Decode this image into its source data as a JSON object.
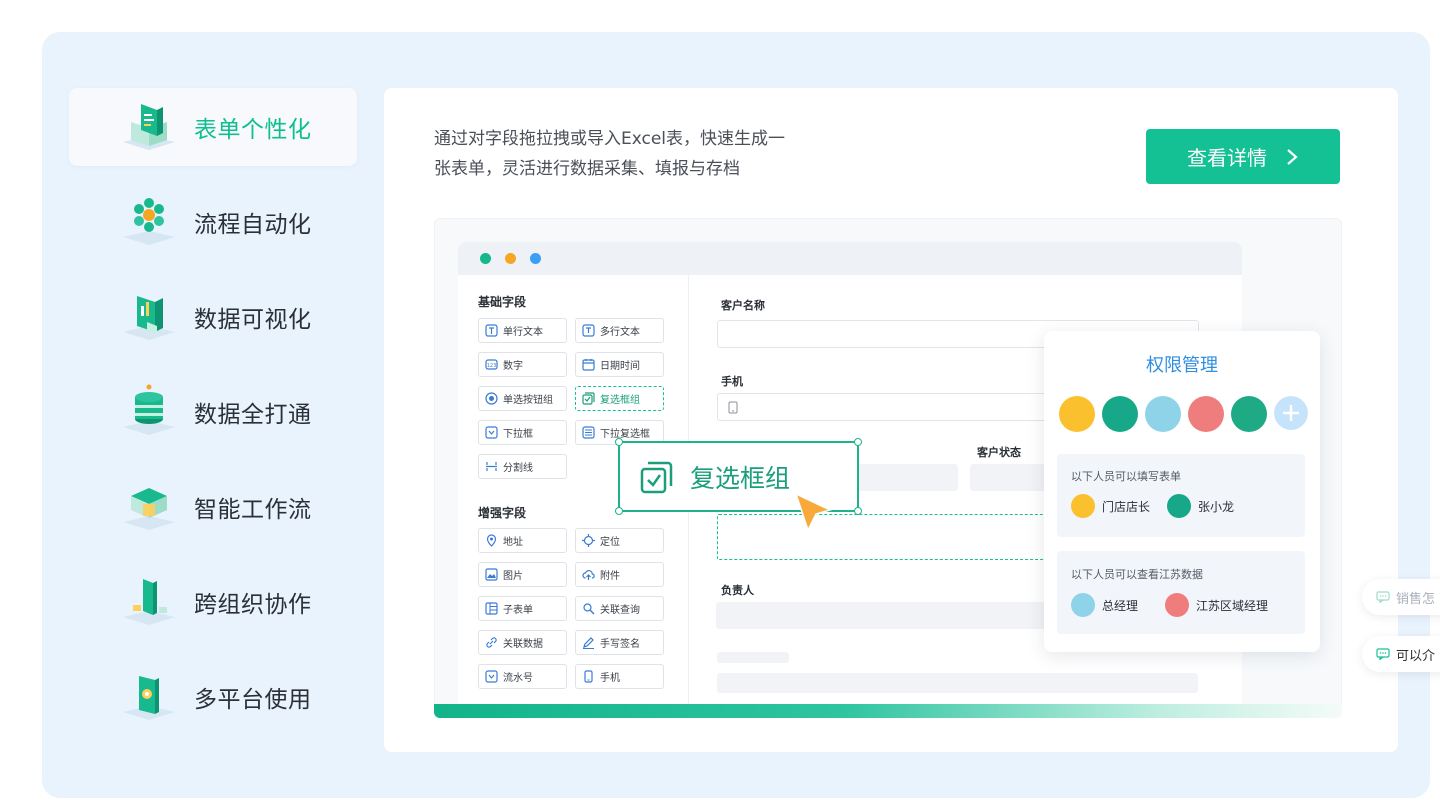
{
  "menu": {
    "items": [
      {
        "label": "表单个性化",
        "icon": "form-icon",
        "active": true
      },
      {
        "label": "流程自动化",
        "icon": "process-icon",
        "active": false
      },
      {
        "label": "数据可视化",
        "icon": "chart-icon",
        "active": false
      },
      {
        "label": "数据全打通",
        "icon": "database-icon",
        "active": false
      },
      {
        "label": "智能工作流",
        "icon": "workflow-icon",
        "active": false
      },
      {
        "label": "跨组织协作",
        "icon": "collaboration-icon",
        "active": false
      },
      {
        "label": "多平台使用",
        "icon": "mobile-icon",
        "active": false
      }
    ]
  },
  "content": {
    "description_line1": "通过对字段拖拉拽或导入Excel表，快速生成一",
    "description_line2": "张表单，灵活进行数据采集、填报与存档",
    "cta_label": "查看详情"
  },
  "builder": {
    "basic_title": "基础字段",
    "basic_fields": [
      "单行文本",
      "多行文本",
      "数字",
      "日期时间",
      "单选按钮组",
      "复选框组",
      "下拉框",
      "下拉复选框",
      "分割线"
    ],
    "enhanced_title": "增强字段",
    "enhanced_fields": [
      "地址",
      "定位",
      "图片",
      "附件",
      "子表单",
      "关联查询",
      "关联数据",
      "手写签名",
      "流水号",
      "手机"
    ],
    "dragging_label": "复选框组",
    "form_labels": {
      "customer_name": "客户名称",
      "phone": "手机",
      "customer_status": "客户状态",
      "owner": "负责人"
    }
  },
  "permission": {
    "title": "权限管理",
    "fill_title": "以下人员可以填写表单",
    "fill_people": [
      "门店店长",
      "张小龙"
    ],
    "view_title": "以下人员可以查看江苏数据",
    "view_people": [
      "总经理",
      "江苏区域经理"
    ]
  },
  "float": {
    "btn1": "销售怎",
    "btn2": "可以介"
  },
  "colors": {
    "accent": "#14c194",
    "brand_blue": "#2f8fe0",
    "background": "#e9f3fd"
  }
}
